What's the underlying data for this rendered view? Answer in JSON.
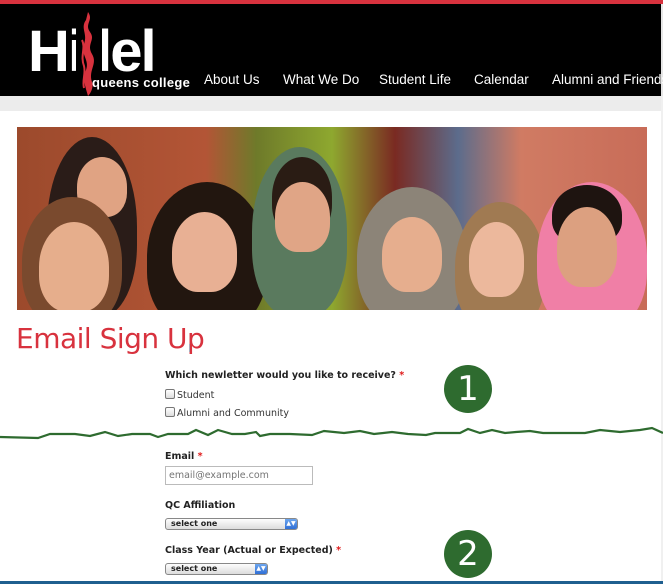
{
  "header": {
    "logo": {
      "wordmark": "Hillel",
      "subtitle": "queens college"
    },
    "nav": [
      {
        "label": "About Us"
      },
      {
        "label": "What We Do"
      },
      {
        "label": "Student Life"
      },
      {
        "label": "Calendar"
      },
      {
        "label": "Alumni and Friends"
      }
    ]
  },
  "hero": {
    "alt": "Group photo of smiling students"
  },
  "page": {
    "title": "Email Sign Up"
  },
  "form": {
    "newsletter": {
      "label": "Which newletter would you like to receive?",
      "required_mark": "*",
      "options": [
        {
          "label": "Student",
          "checked": false
        },
        {
          "label": "Alumni and Community",
          "checked": false
        }
      ]
    },
    "email": {
      "label": "Email",
      "required_mark": "*",
      "placeholder": "email@example.com",
      "value": ""
    },
    "affiliation": {
      "label": "QC Affiliation",
      "selected": "select one"
    },
    "class_year": {
      "label": "Class Year (Actual or Expected)",
      "required_mark": "*",
      "selected": "select one"
    }
  },
  "annotations": {
    "step1": "1",
    "step2": "2"
  },
  "colors": {
    "brand_red": "#d8323e",
    "annotation_green": "#2e6b2f",
    "header_bg": "#000000",
    "required": "#e01b1b"
  }
}
